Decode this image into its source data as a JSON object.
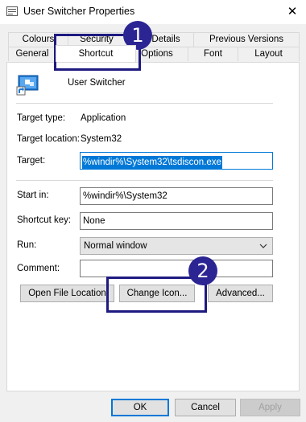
{
  "window": {
    "title": "User Switcher Properties",
    "close_glyph": "✕"
  },
  "tabs_row1": [
    {
      "label": "Colours"
    },
    {
      "label": "Security"
    },
    {
      "label": "Details"
    },
    {
      "label": "Previous Versions"
    }
  ],
  "tabs_row2": [
    {
      "label": "General"
    },
    {
      "label": "Shortcut"
    },
    {
      "label": "Options"
    },
    {
      "label": "Font"
    },
    {
      "label": "Layout"
    }
  ],
  "active_tab": "Shortcut",
  "shortcut": {
    "name": "User Switcher",
    "target_type_label": "Target type:",
    "target_type_value": "Application",
    "target_location_label": "Target location:",
    "target_location_value": "System32",
    "target_label": "Target:",
    "target_value": "%windir%\\System32\\tsdiscon.exe",
    "start_in_label": "Start in:",
    "start_in_value": "%windir%\\System32",
    "shortcut_key_label": "Shortcut key:",
    "shortcut_key_value": "None",
    "run_label": "Run:",
    "run_value": "Normal window",
    "comment_label": "Comment:",
    "comment_value": ""
  },
  "buttons": {
    "open_file_location": "Open File Location",
    "change_icon": "Change Icon...",
    "advanced": "Advanced...",
    "ok": "OK",
    "cancel": "Cancel",
    "apply": "Apply"
  },
  "callouts": [
    {
      "number": "1"
    },
    {
      "number": "2"
    }
  ],
  "colors": {
    "callout": "#2b2593",
    "selection": "#0078d7"
  }
}
